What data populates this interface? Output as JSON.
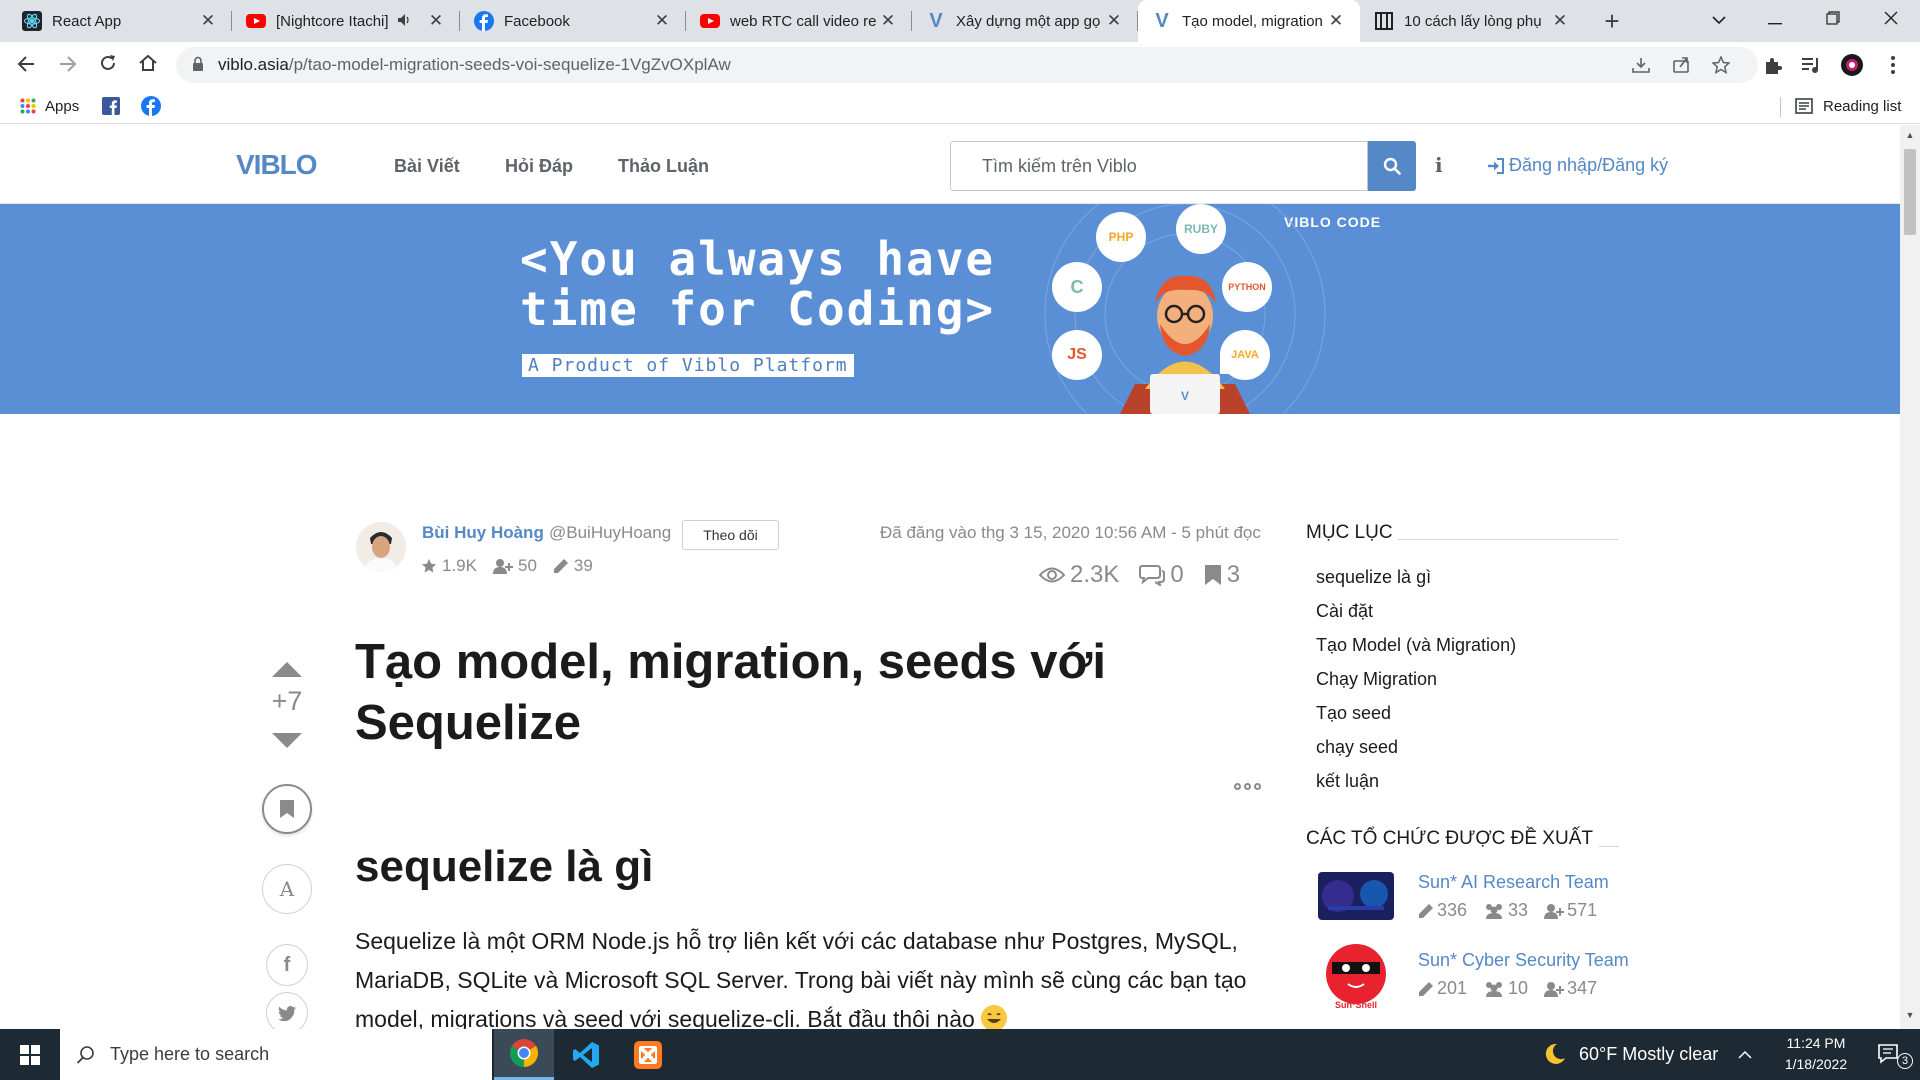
{
  "browser": {
    "tabs": [
      {
        "title": "React App",
        "icon": "react-icon",
        "active": false
      },
      {
        "title": "[Nightcore Itachi]",
        "icon": "youtube-icon",
        "audio": true,
        "active": false
      },
      {
        "title": "Facebook",
        "icon": "facebook-icon",
        "active": false
      },
      {
        "title": "web RTC call video re",
        "icon": "youtube-icon",
        "active": false
      },
      {
        "title": "Xây dựng một app gọ",
        "icon": "viblo-icon",
        "active": false
      },
      {
        "title": "Tạo model, migration",
        "icon": "viblo-icon",
        "active": true
      },
      {
        "title": "10 cách lấy lòng phụ",
        "icon": "site-icon",
        "active": false
      }
    ],
    "url_host": "viblo.asia",
    "url_path": "/p/tao-model-migration-seeds-voi-sequelize-1VgZvOXplAw",
    "bookmarks": {
      "apps_label": "Apps",
      "reading_list_label": "Reading list"
    }
  },
  "site": {
    "logo": "VIBLO",
    "nav": [
      "Bài Viết",
      "Hỏi Đáp",
      "Thảo Luận"
    ],
    "search_placeholder": "Tìm kiếm trên Viblo",
    "login_label": "Đăng nhập/Đăng ký",
    "banner": {
      "line1": "<You always have",
      "line2": "time for Coding>",
      "sub": "A Product of Viblo Platform",
      "brand": "VIBLO CODE",
      "bubbles": [
        "PHP",
        "RUBY",
        "C",
        "PYTHON",
        "JS",
        "JAVA"
      ]
    }
  },
  "article": {
    "author_name": "Bùi Huy Hoàng",
    "author_handle": "@BuiHuyHoang",
    "follow_label": "Theo dõi",
    "author_stats": {
      "reputation": "1.9K",
      "followers": "50",
      "posts": "39"
    },
    "posted": "Đã đăng vào thg 3 15, 2020 10:56 AM - 5 phút đọc",
    "stats": {
      "views": "2.3K",
      "comments": "0",
      "bookmarks": "3"
    },
    "votes": "+7",
    "title": "Tạo model, migration, seeds với Sequelize",
    "section_heading": "sequelize là gì",
    "paragraph": "Sequelize là một ORM Node.js hỗ trợ liên kết với các database như Postgres, MySQL, MariaDB, SQLite và Microsoft SQL Server. Trong bài viết này mình sẽ cùng các bạn tạo model, migrations và seed với sequelize-cli. Bắt đầu thôi nào"
  },
  "sidebar": {
    "toc_title": "MỤC LỤC",
    "toc": [
      "sequelize là gì",
      "Cài đặt",
      "Tạo Model (và Migration)",
      "Chạy Migration",
      "Tạo seed",
      "chạy seed",
      "kết luận"
    ],
    "orgs_title": "CÁC TỔ CHỨC ĐƯỢC ĐỀ XUẤT",
    "orgs": [
      {
        "name": "Sun* AI Research Team",
        "posts": "336",
        "members": "33",
        "followers": "571"
      },
      {
        "name": "Sun* Cyber Security Team",
        "posts": "201",
        "members": "10",
        "followers": "347",
        "logo_text": "Sun*Shell"
      }
    ]
  },
  "taskbar": {
    "search_placeholder": "Type here to search",
    "weather": "60°F  Mostly clear",
    "time": "11:24 PM",
    "date": "1/18/2022",
    "notifications": "3"
  },
  "colors": {
    "accent": "#5488c7",
    "banner": "#5b8fd5",
    "taskbar": "#1e2a33"
  }
}
